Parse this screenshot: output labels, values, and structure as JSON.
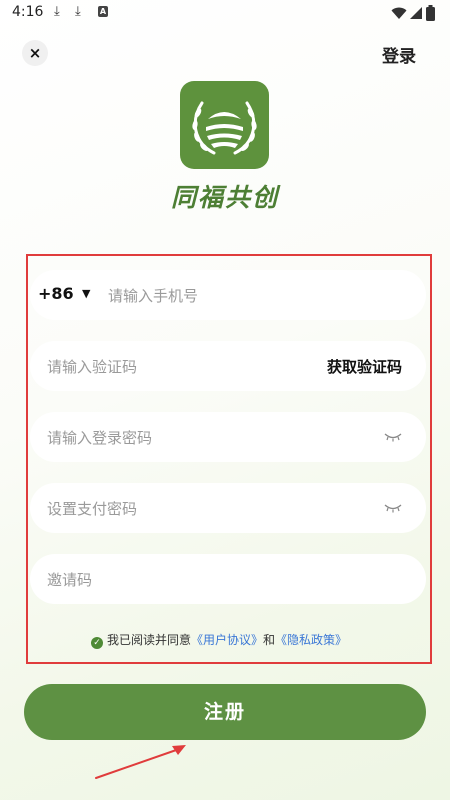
{
  "status_bar": {
    "time": "4:16",
    "left_icons": [
      "download-icon",
      "download-icon",
      "a-app-icon"
    ],
    "right_icons": [
      "wifi-icon",
      "signal-icon",
      "battery-icon"
    ]
  },
  "header": {
    "close_icon": "×",
    "login_label": "登录"
  },
  "brand": {
    "app_name": "同福共创",
    "logo_color": "#5e923d"
  },
  "form": {
    "phone": {
      "country_code": "+86",
      "placeholder": "请输入手机号"
    },
    "verify_code": {
      "placeholder": "请输入验证码",
      "get_code_label": "获取验证码"
    },
    "login_password": {
      "placeholder": "请输入登录密码"
    },
    "pay_password": {
      "placeholder": "设置支付密码"
    },
    "invite_code": {
      "placeholder": "邀请码"
    }
  },
  "agreement": {
    "prefix": "我已阅读并同意",
    "user_agreement": "《用户协议》",
    "and": "和",
    "privacy_policy": "《隐私政策》"
  },
  "register_label": "注册",
  "colors": {
    "primary": "#5e9143",
    "annotation_red": "#e03c3c",
    "link": "#3a77d6"
  }
}
